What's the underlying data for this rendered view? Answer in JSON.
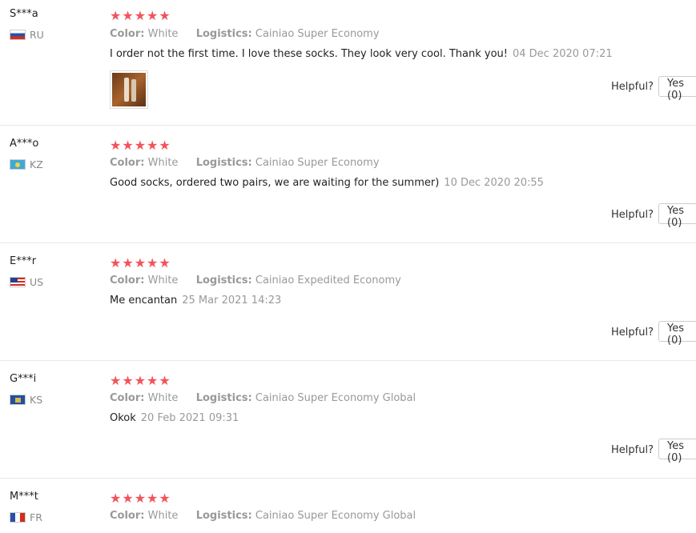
{
  "labels": {
    "color_key": "Color:",
    "logistics_key": "Logistics:",
    "helpful": "Helpful?",
    "yes": "Yes (0)",
    "stars": "★★★★★"
  },
  "reviews": [
    {
      "user": "S***a",
      "country": "RU",
      "color": "White",
      "logistics": "Cainiao Super Economy",
      "text": "I order not the first time. I love these socks. They look very cool. Thank you!",
      "date": "04 Dec 2020 07:21",
      "rating": 5,
      "has_image": true
    },
    {
      "user": "A***o",
      "country": "KZ",
      "color": "White",
      "logistics": "Cainiao Super Economy",
      "text": "Good socks, ordered two pairs, we are waiting for the summer)",
      "date": "10 Dec 2020 20:55",
      "rating": 5
    },
    {
      "user": "E***r",
      "country": "US",
      "color": "White",
      "logistics": "Cainiao Expedited Economy",
      "text": "Me encantan",
      "date": "25 Mar 2021 14:23",
      "rating": 5
    },
    {
      "user": "G***i",
      "country": "KS",
      "color": "White",
      "logistics": "Cainiao Super Economy Global",
      "text": "Okok",
      "date": "20 Feb 2021 09:31",
      "rating": 5
    },
    {
      "user": "M***t",
      "country": "FR",
      "color": "White",
      "logistics": "Cainiao Super Economy Global",
      "rating": 5
    }
  ]
}
